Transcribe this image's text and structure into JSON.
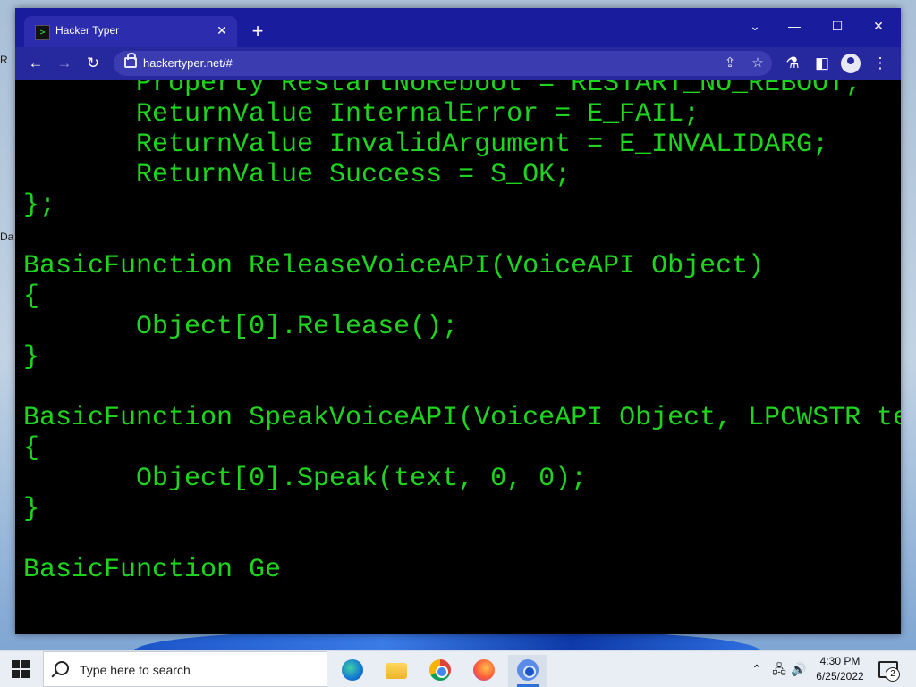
{
  "desktop": {
    "icon_label_1": "R",
    "icon_label_2": "Da"
  },
  "browser": {
    "tab": {
      "title": "Hacker Typer",
      "favicon_text": ">"
    },
    "address": {
      "url": "hackertyper.net/#"
    },
    "window_controls": [
      "chevron-down-icon",
      "minimize-icon",
      "maximize-icon",
      "close-icon"
    ]
  },
  "code": {
    "lines": [
      "       Property RestartNoReboot = RESTART_NO_REBOOT;",
      "       ReturnValue InternalError = E_FAIL;",
      "       ReturnValue InvalidArgument = E_INVALIDARG;",
      "       ReturnValue Success = S_OK;",
      "};",
      "",
      "BasicFunction ReleaseVoiceAPI(VoiceAPI Object)",
      "{",
      "       Object[0].Release();",
      "}",
      "",
      "BasicFunction SpeakVoiceAPI(VoiceAPI Object, LPCWSTR te",
      "{",
      "       Object[0].Speak(text, 0, 0);",
      "}",
      "",
      "BasicFunction Ge"
    ],
    "text_color": "#1fd41f"
  },
  "taskbar": {
    "search_placeholder": "Type here to search",
    "apps": [
      "edge-icon",
      "file-explorer-icon",
      "chrome-icon",
      "firefox-icon",
      "chromium-icon"
    ],
    "time": "4:30 PM",
    "date": "6/25/2022",
    "notification_count": "2"
  }
}
